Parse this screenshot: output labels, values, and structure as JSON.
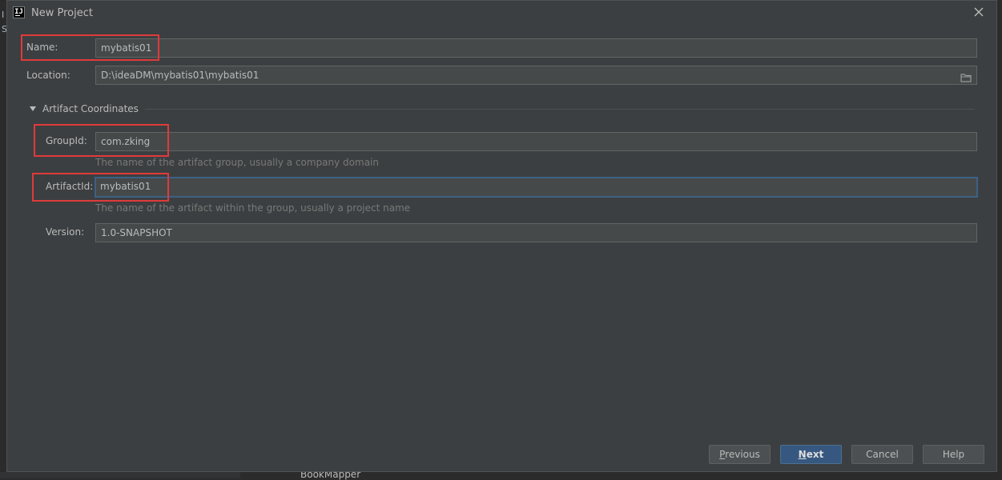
{
  "dialog": {
    "title": "New Project"
  },
  "fields": {
    "name": {
      "label": "Name:",
      "value": "mybatis01"
    },
    "location": {
      "label": "Location:",
      "value": "D:\\ideaDM\\mybatis01\\mybatis01"
    }
  },
  "artifact": {
    "section_title": "Artifact Coordinates",
    "group_id": {
      "label": "GroupId:",
      "value": "com.zking",
      "hint": "The name of the artifact group, usually a company domain"
    },
    "artifact_id": {
      "label": "ArtifactId:",
      "value": "mybatis01",
      "hint": "The name of the artifact within the group, usually a project name"
    },
    "version": {
      "label": "Version:",
      "value": "1.0-SNAPSHOT"
    }
  },
  "buttons": {
    "previous": {
      "mnemonic": "P",
      "rest": "revious"
    },
    "next": {
      "mnemonic": "N",
      "rest": "ext"
    },
    "cancel": "Cancel",
    "help": "Help"
  },
  "background": {
    "left_chars": [
      "I",
      "S"
    ],
    "bottom_text": "BookMapper"
  },
  "icons": {
    "app": "intellij-idea-icon",
    "close": "close-icon",
    "browse": "folder-icon",
    "expand": "triangle-down-icon"
  },
  "colors": {
    "dialog_bg": "#3c3f41",
    "field_bg": "#45494a",
    "focus_border": "#3d6185",
    "primary_button": "#365880",
    "annotation_red": "#e03a3a"
  }
}
